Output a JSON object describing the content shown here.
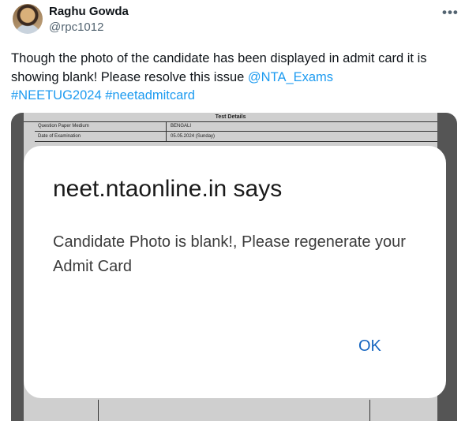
{
  "author": {
    "name": "Raghu Gowda",
    "handle": "@rpc1012"
  },
  "more_glyph": "•••",
  "tweet": {
    "text": "Though the photo of the candidate has been displayed in admit card it is showing blank! Please resolve this issue ",
    "mention": "@NTA_Exams",
    "hashtag1": "#NEETUG2024",
    "hashtag2": "#neetadmitcard"
  },
  "document": {
    "title": "Test Details",
    "rows": [
      {
        "label": "Question Paper Medium",
        "value": "BENGALI"
      },
      {
        "label": "Date of Examination",
        "value": "05.05.2024 (Sunday)"
      }
    ]
  },
  "dialog": {
    "title": "neet.ntaonline.in says",
    "message": "Candidate Photo is blank!, Please regenerate your Admit Card",
    "ok_label": "OK"
  },
  "colors": {
    "link": "#1d9bf0",
    "dialog_button": "#1565c0"
  }
}
